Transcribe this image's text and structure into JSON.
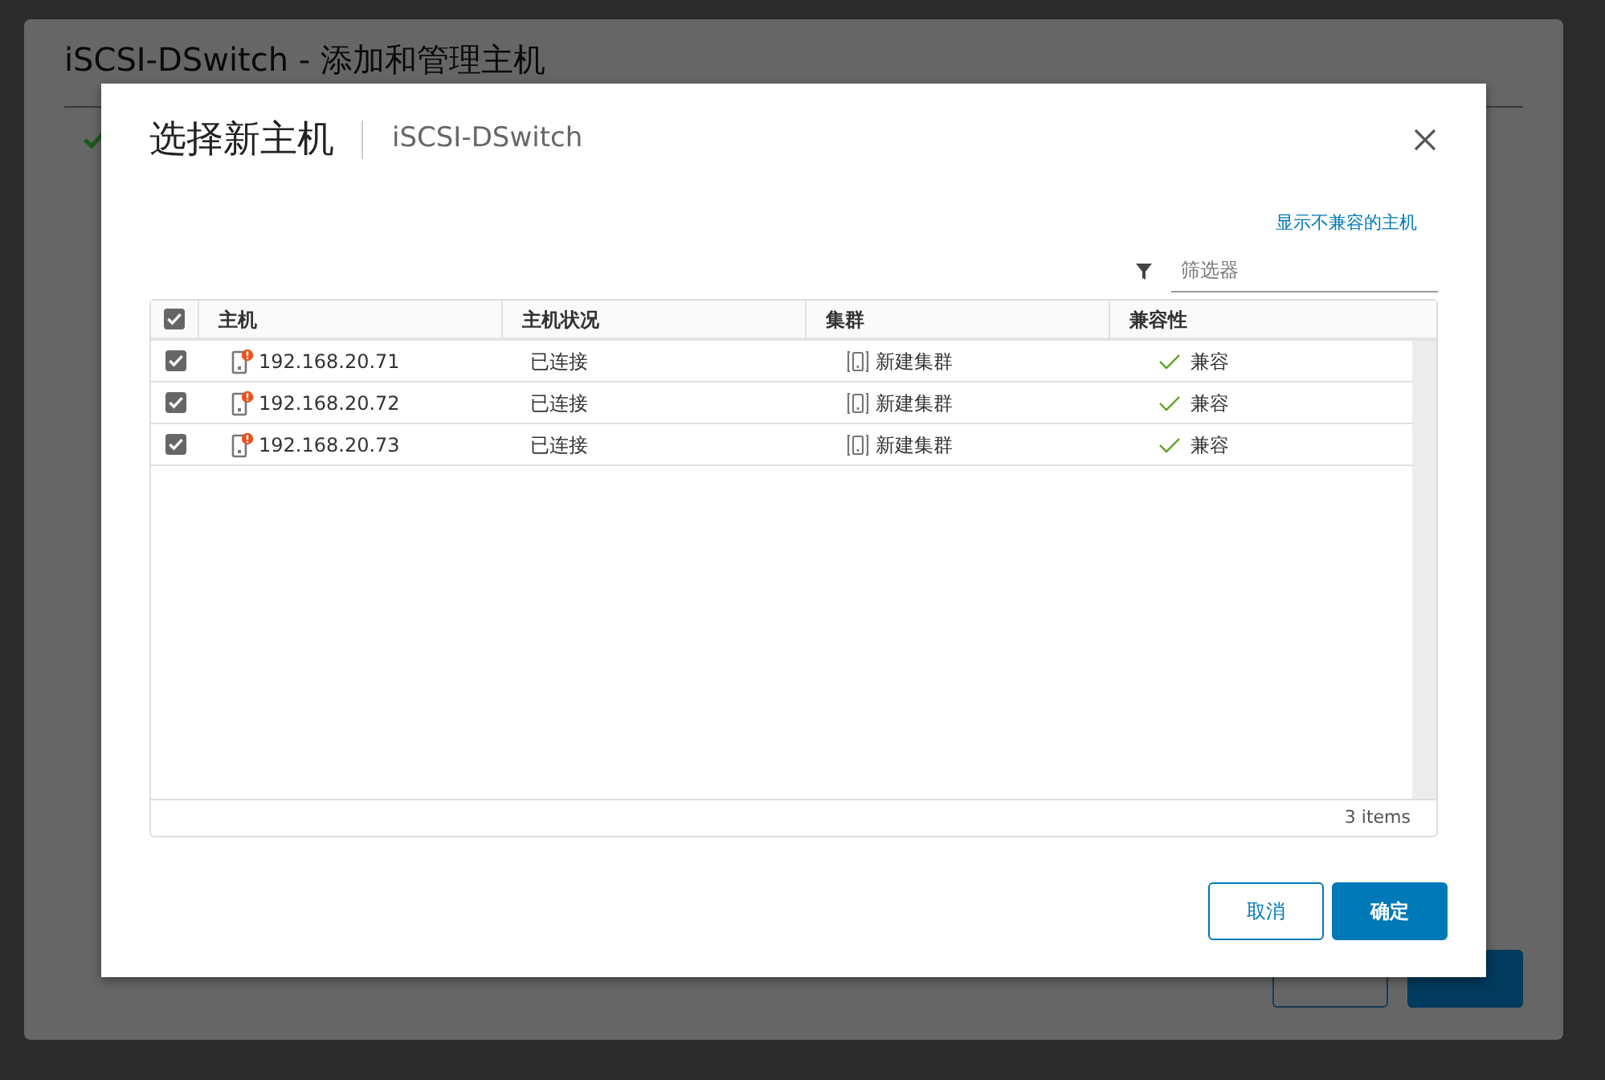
{
  "background_dialog": {
    "title": "iSCSI-DSwitch - 添加和管理主机",
    "buttons": [
      {
        "kind": "outline"
      },
      {
        "kind": "primary"
      }
    ]
  },
  "modal": {
    "title": "选择新主机",
    "subtitle": "iSCSI-DSwitch",
    "link": "显示不兼容的主机",
    "filter": {
      "placeholder": "筛选器"
    },
    "table": {
      "select_all_checked": true,
      "columns": [
        "主机",
        "主机状况",
        "集群",
        "兼容性"
      ],
      "rows": [
        {
          "checked": true,
          "host": "192.168.20.71",
          "status": "已连接",
          "cluster": "新建集群",
          "compatibility": "兼容"
        },
        {
          "checked": true,
          "host": "192.168.20.72",
          "status": "已连接",
          "cluster": "新建集群",
          "compatibility": "兼容"
        },
        {
          "checked": true,
          "host": "192.168.20.73",
          "status": "已连接",
          "cluster": "新建集群",
          "compatibility": "兼容"
        }
      ],
      "footer": "3 items"
    },
    "buttons": [
      {
        "label": "取消",
        "kind": "outline"
      },
      {
        "label": "确定",
        "kind": "primary"
      }
    ]
  }
}
